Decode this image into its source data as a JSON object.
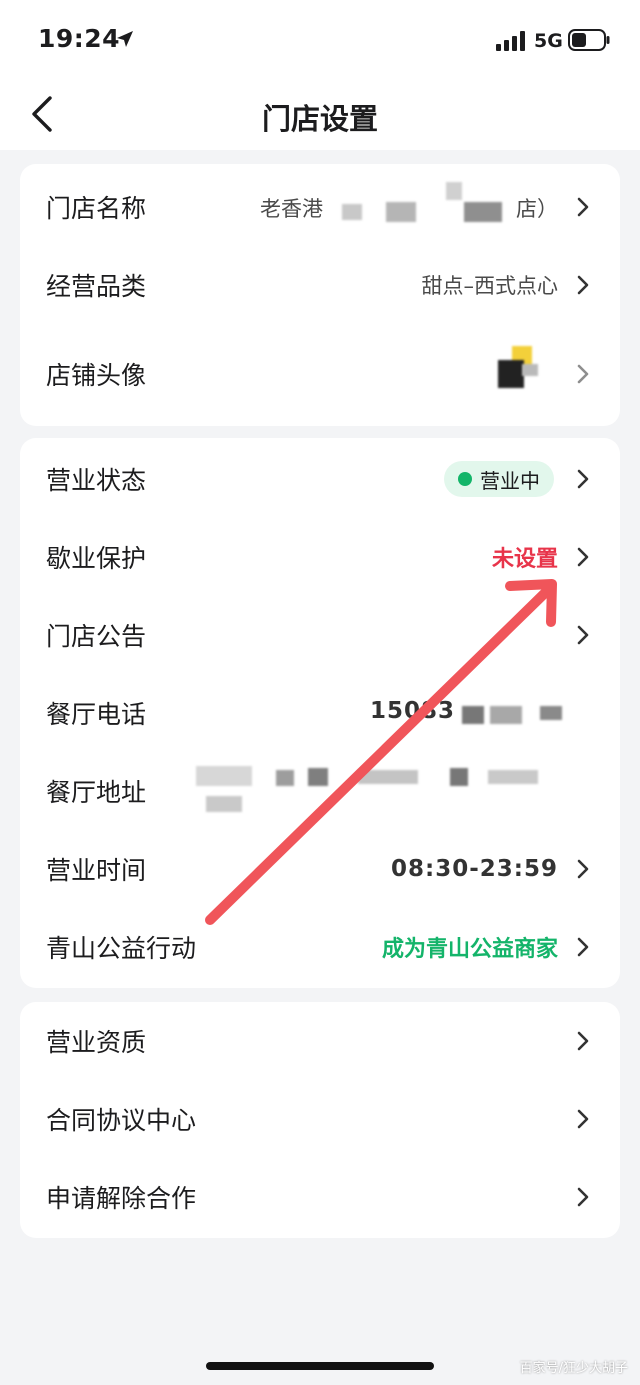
{
  "status_bar": {
    "time": "19:24",
    "network": "5G",
    "icons": [
      "location-arrow-icon",
      "signal-bars-icon",
      "battery-icon"
    ]
  },
  "nav": {
    "title": "门店设置",
    "back_icon": "chevron-left-icon"
  },
  "card1": {
    "rows": [
      {
        "label": "门店名称",
        "value": "老香港",
        "value_suffix": "店）"
      },
      {
        "label": "经营品类",
        "value": "甜点–西式点心"
      },
      {
        "label": "店铺头像"
      }
    ]
  },
  "card2": {
    "rows": [
      {
        "label": "营业状态",
        "value": "营业中"
      },
      {
        "label": "歇业保护",
        "value": "未设置"
      },
      {
        "label": "门店公告"
      },
      {
        "label": "餐厅电话",
        "value": "15083"
      },
      {
        "label": "餐厅地址"
      },
      {
        "label": "营业时间",
        "value": "08:30-23:59"
      },
      {
        "label": "青山公益行动",
        "value": "成为青山公益商家"
      }
    ]
  },
  "card3": {
    "rows": [
      {
        "label": "营业资质"
      },
      {
        "label": "合同协议中心"
      },
      {
        "label": "申请解除合作"
      }
    ]
  },
  "colors": {
    "accent_green": "#14b46a",
    "alert_red": "#e8344a",
    "annotation_arrow": "#f0555a",
    "badge_bg": "#e2f7ec"
  },
  "watermark": "百家号/狂少大胡子"
}
